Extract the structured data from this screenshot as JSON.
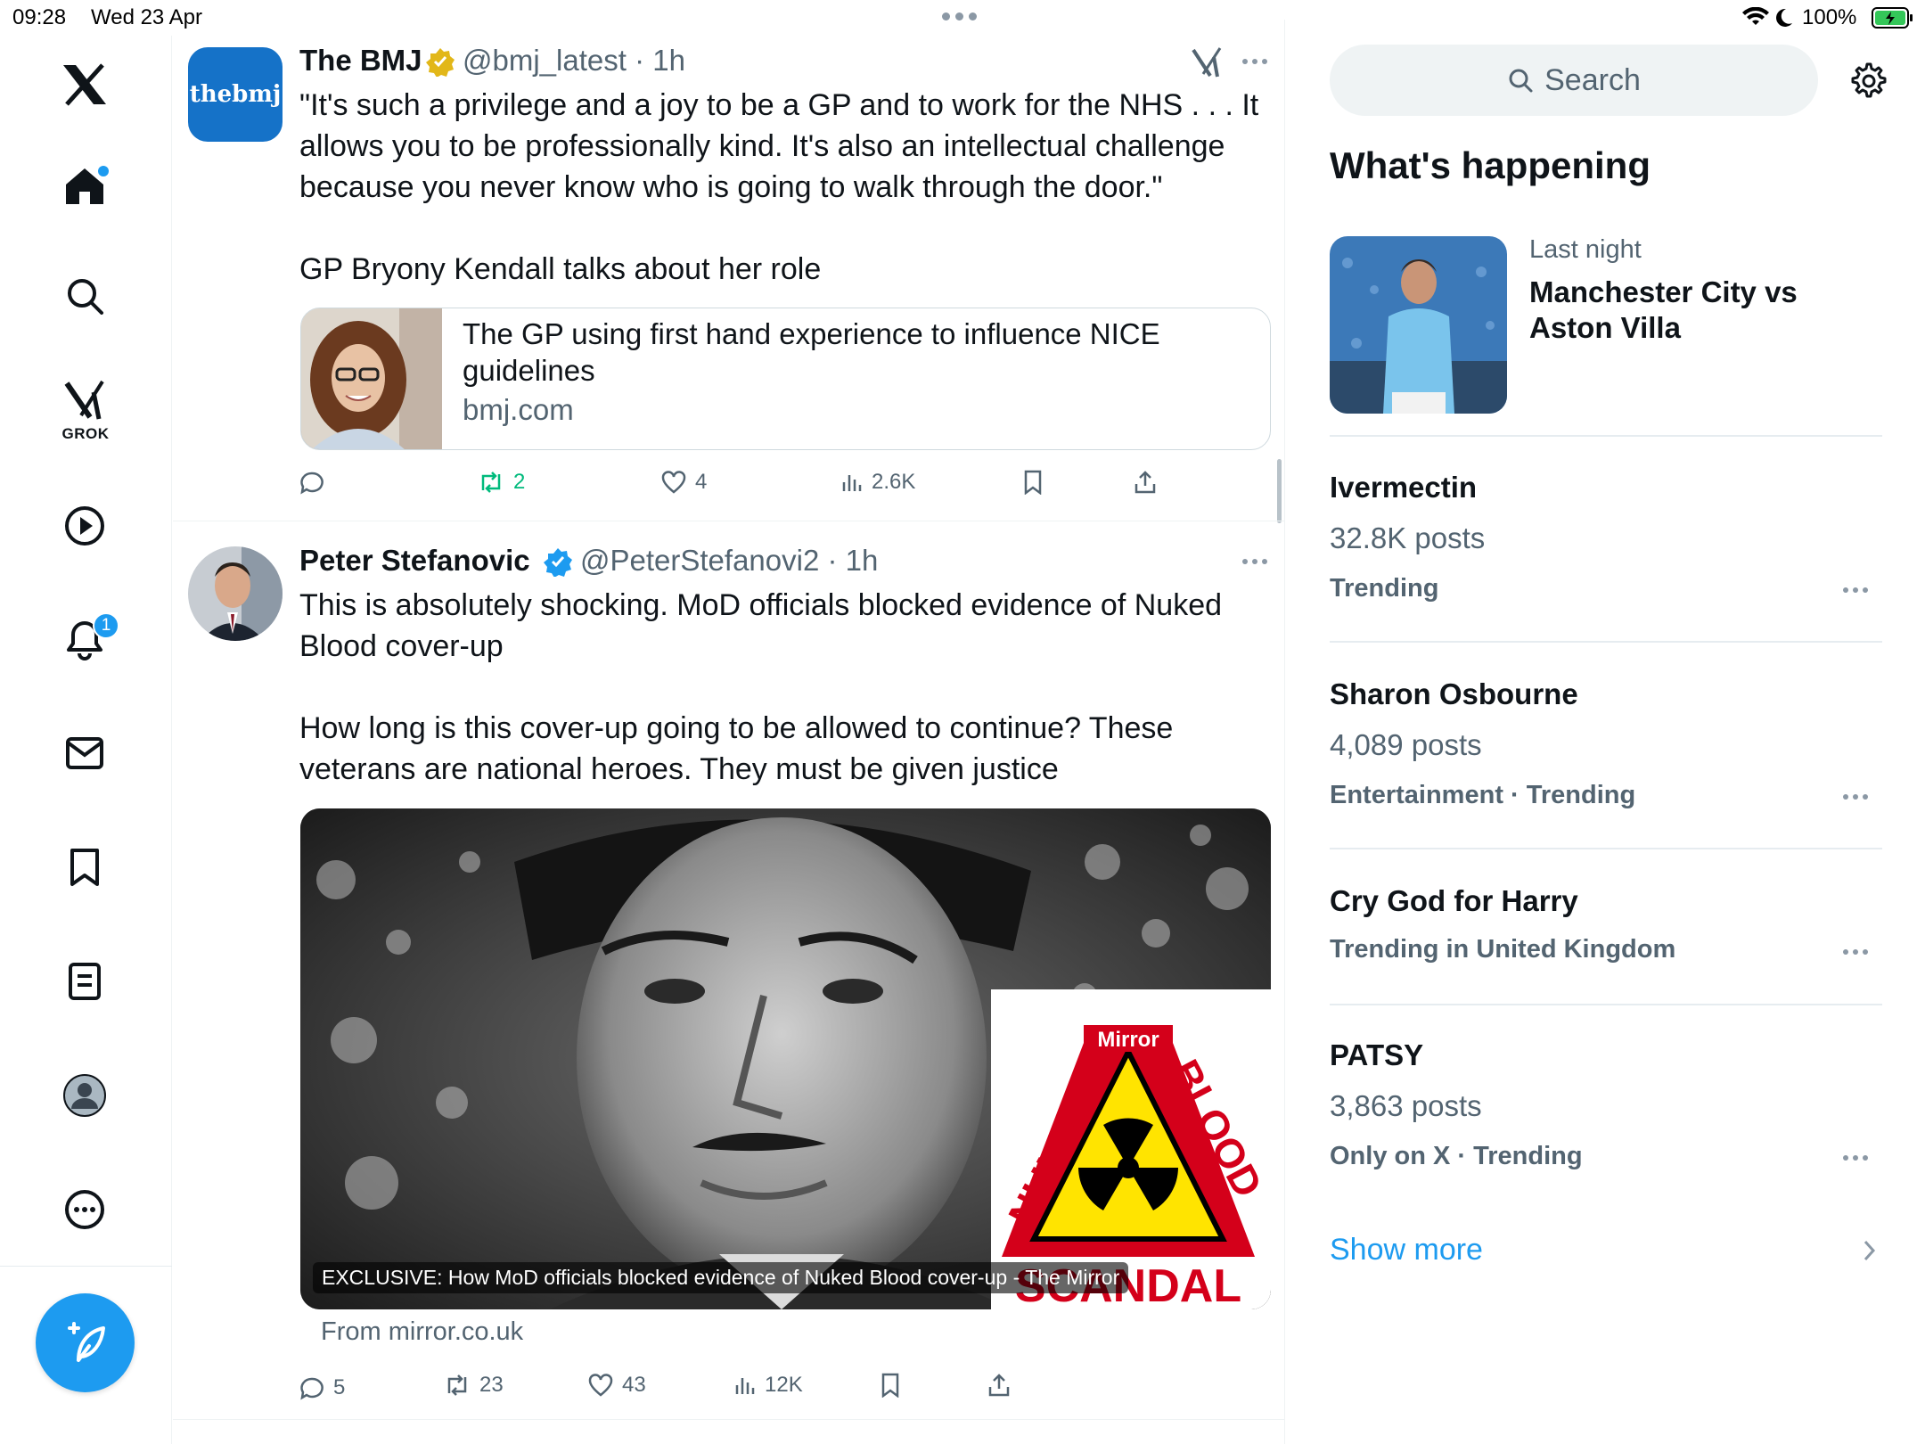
{
  "status_bar": {
    "time": "09:28",
    "date": "Wed 23 Apr",
    "battery": "100%"
  },
  "nav": {
    "grok_label": "GROK",
    "notifications_count": "1",
    "accent_color": "#1d9bf0"
  },
  "tweets": [
    {
      "name": "The BMJ",
      "handle": "@bmj_latest · 1h",
      "avatar_text": "thebmj",
      "text": "\"It's such a privilege and a joy to be a GP and to work for the NHS . . . It\nallows you to be professionally kind. It's also an intellectual challenge\nbecause you never know who is going to walk through the door.\"\n\nGP Bryony Kendall talks about her role",
      "card": {
        "title": "The GP using first hand experience to influence NICE\nguidelines",
        "domain": "bmj.com"
      },
      "actions": {
        "replies": "",
        "reposts": "2",
        "likes": "4",
        "views": "2.6K"
      }
    },
    {
      "name": "Peter Stefanovic",
      "handle": "@PeterStefanovi2 · 1h",
      "text": "This is absolutely shocking. MoD officials blocked evidence of Nuked\nBlood cover-up\n\nHow long is this cover-up going to be allowed to continue? These\nveterans are national heroes. They must be given justice",
      "card": {
        "caption": "EXCLUSIVE: How MoD officials blocked evidence of Nuked Blood cover-up - The Mirror",
        "source": "From mirror.co.uk",
        "logo_mirror": "Mirror",
        "logo_nuke": "NUKE",
        "logo_blood": "BLOOD",
        "logo_scandal": "SCANDAL"
      },
      "actions": {
        "replies": "5",
        "reposts": "23",
        "likes": "43",
        "views": "12K"
      }
    }
  ],
  "sidebar": {
    "search_placeholder": "Search",
    "section_title": "What's happening",
    "featured": {
      "sub": "Last night",
      "title": "Manchester City vs\nAston Villa"
    },
    "trends": [
      {
        "title": "Ivermectin",
        "posts": "32.8K posts",
        "meta": "Trending"
      },
      {
        "title": "Sharon Osbourne",
        "posts": "4,089 posts",
        "meta": "Entertainment · Trending"
      },
      {
        "title": "Cry God for Harry",
        "posts": "",
        "meta": "Trending in United Kingdom"
      },
      {
        "title": "PATSY",
        "posts": "3,863 posts",
        "meta": "Only on X · Trending"
      }
    ],
    "show_more": "Show more"
  }
}
